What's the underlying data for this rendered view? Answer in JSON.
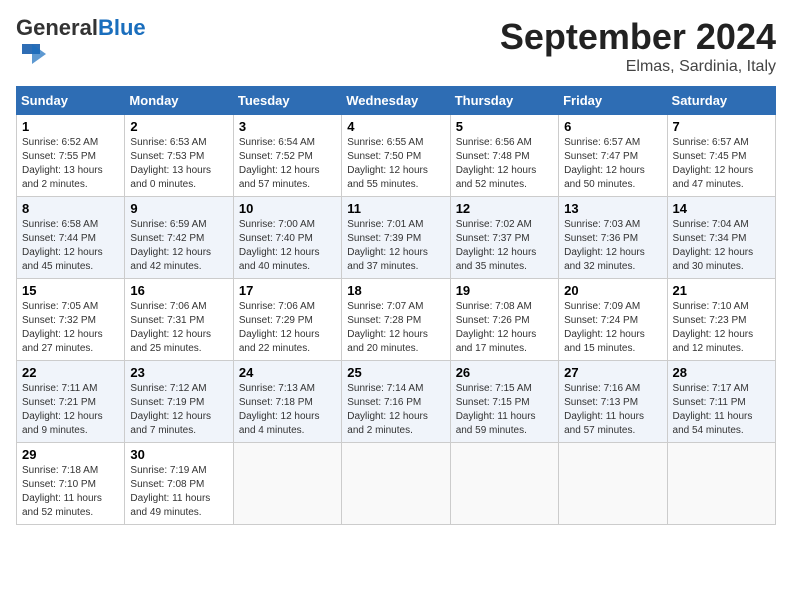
{
  "header": {
    "logo_general": "General",
    "logo_blue": "Blue",
    "month_title": "September 2024",
    "location": "Elmas, Sardinia, Italy"
  },
  "weekdays": [
    "Sunday",
    "Monday",
    "Tuesday",
    "Wednesday",
    "Thursday",
    "Friday",
    "Saturday"
  ],
  "weeks": [
    [
      {
        "day": "1",
        "sunrise": "6:52 AM",
        "sunset": "7:55 PM",
        "daylight": "13 hours and 2 minutes."
      },
      {
        "day": "2",
        "sunrise": "6:53 AM",
        "sunset": "7:53 PM",
        "daylight": "13 hours and 0 minutes."
      },
      {
        "day": "3",
        "sunrise": "6:54 AM",
        "sunset": "7:52 PM",
        "daylight": "12 hours and 57 minutes."
      },
      {
        "day": "4",
        "sunrise": "6:55 AM",
        "sunset": "7:50 PM",
        "daylight": "12 hours and 55 minutes."
      },
      {
        "day": "5",
        "sunrise": "6:56 AM",
        "sunset": "7:48 PM",
        "daylight": "12 hours and 52 minutes."
      },
      {
        "day": "6",
        "sunrise": "6:57 AM",
        "sunset": "7:47 PM",
        "daylight": "12 hours and 50 minutes."
      },
      {
        "day": "7",
        "sunrise": "6:57 AM",
        "sunset": "7:45 PM",
        "daylight": "12 hours and 47 minutes."
      }
    ],
    [
      {
        "day": "8",
        "sunrise": "6:58 AM",
        "sunset": "7:44 PM",
        "daylight": "12 hours and 45 minutes."
      },
      {
        "day": "9",
        "sunrise": "6:59 AM",
        "sunset": "7:42 PM",
        "daylight": "12 hours and 42 minutes."
      },
      {
        "day": "10",
        "sunrise": "7:00 AM",
        "sunset": "7:40 PM",
        "daylight": "12 hours and 40 minutes."
      },
      {
        "day": "11",
        "sunrise": "7:01 AM",
        "sunset": "7:39 PM",
        "daylight": "12 hours and 37 minutes."
      },
      {
        "day": "12",
        "sunrise": "7:02 AM",
        "sunset": "7:37 PM",
        "daylight": "12 hours and 35 minutes."
      },
      {
        "day": "13",
        "sunrise": "7:03 AM",
        "sunset": "7:36 PM",
        "daylight": "12 hours and 32 minutes."
      },
      {
        "day": "14",
        "sunrise": "7:04 AM",
        "sunset": "7:34 PM",
        "daylight": "12 hours and 30 minutes."
      }
    ],
    [
      {
        "day": "15",
        "sunrise": "7:05 AM",
        "sunset": "7:32 PM",
        "daylight": "12 hours and 27 minutes."
      },
      {
        "day": "16",
        "sunrise": "7:06 AM",
        "sunset": "7:31 PM",
        "daylight": "12 hours and 25 minutes."
      },
      {
        "day": "17",
        "sunrise": "7:06 AM",
        "sunset": "7:29 PM",
        "daylight": "12 hours and 22 minutes."
      },
      {
        "day": "18",
        "sunrise": "7:07 AM",
        "sunset": "7:28 PM",
        "daylight": "12 hours and 20 minutes."
      },
      {
        "day": "19",
        "sunrise": "7:08 AM",
        "sunset": "7:26 PM",
        "daylight": "12 hours and 17 minutes."
      },
      {
        "day": "20",
        "sunrise": "7:09 AM",
        "sunset": "7:24 PM",
        "daylight": "12 hours and 15 minutes."
      },
      {
        "day": "21",
        "sunrise": "7:10 AM",
        "sunset": "7:23 PM",
        "daylight": "12 hours and 12 minutes."
      }
    ],
    [
      {
        "day": "22",
        "sunrise": "7:11 AM",
        "sunset": "7:21 PM",
        "daylight": "12 hours and 9 minutes."
      },
      {
        "day": "23",
        "sunrise": "7:12 AM",
        "sunset": "7:19 PM",
        "daylight": "12 hours and 7 minutes."
      },
      {
        "day": "24",
        "sunrise": "7:13 AM",
        "sunset": "7:18 PM",
        "daylight": "12 hours and 4 minutes."
      },
      {
        "day": "25",
        "sunrise": "7:14 AM",
        "sunset": "7:16 PM",
        "daylight": "12 hours and 2 minutes."
      },
      {
        "day": "26",
        "sunrise": "7:15 AM",
        "sunset": "7:15 PM",
        "daylight": "11 hours and 59 minutes."
      },
      {
        "day": "27",
        "sunrise": "7:16 AM",
        "sunset": "7:13 PM",
        "daylight": "11 hours and 57 minutes."
      },
      {
        "day": "28",
        "sunrise": "7:17 AM",
        "sunset": "7:11 PM",
        "daylight": "11 hours and 54 minutes."
      }
    ],
    [
      {
        "day": "29",
        "sunrise": "7:18 AM",
        "sunset": "7:10 PM",
        "daylight": "11 hours and 52 minutes."
      },
      {
        "day": "30",
        "sunrise": "7:19 AM",
        "sunset": "7:08 PM",
        "daylight": "11 hours and 49 minutes."
      },
      null,
      null,
      null,
      null,
      null
    ]
  ]
}
